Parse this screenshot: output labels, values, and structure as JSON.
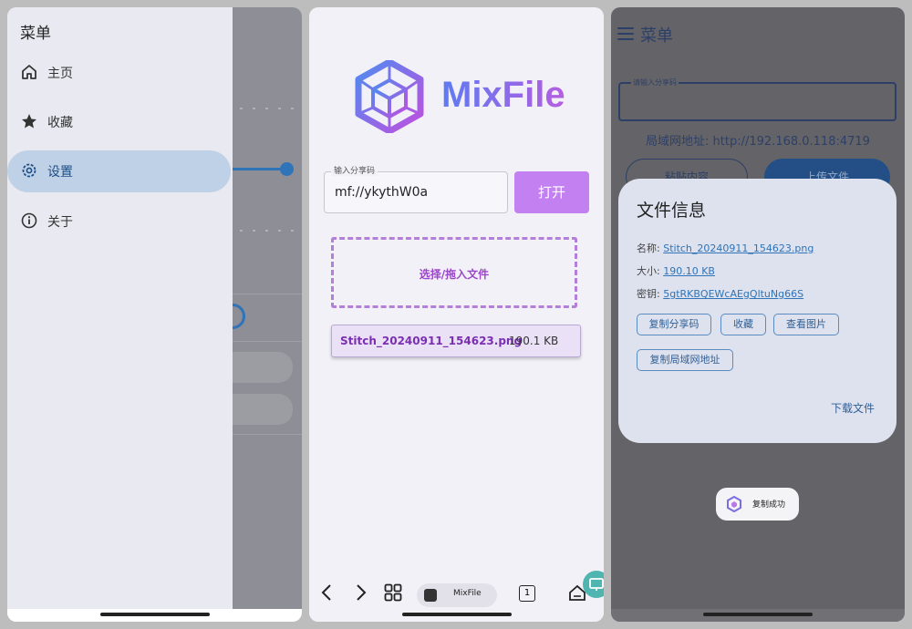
{
  "panel1": {
    "drawer_title": "菜单",
    "items": [
      {
        "label": "主页",
        "icon": "home-icon"
      },
      {
        "label": "收藏",
        "icon": "star-icon"
      },
      {
        "label": "设置",
        "icon": "gear-icon",
        "selected": true
      },
      {
        "label": "关于",
        "icon": "info-icon"
      }
    ],
    "accent": "#2f73b8"
  },
  "panel2": {
    "app_name": "MixFile",
    "share_code_label": "输入分享码",
    "share_code_value": "mf://ykythW0a",
    "open_button": "打开",
    "dropzone_text": "选择/拖入文件",
    "file_name": "Stitch_20240911_154623.png",
    "file_size": "190.1 KB",
    "browser_tab_title": "MixFile",
    "tab_count": "1",
    "brand_color": "#c280f0"
  },
  "panel3": {
    "title": "菜单",
    "input_placeholder": "请输入分享码",
    "lan_address": "局域网地址: http://192.168.0.118:4719",
    "paste_button": "粘贴内容",
    "upload_button": "上传文件",
    "dialog": {
      "title": "文件信息",
      "name_label": "名称:",
      "name_value": "Stitch_20240911_154623.png",
      "size_label": "大小:",
      "size_value": "190.10 KB",
      "key_label": "密钥:",
      "key_value": "5gtRKBQEWcAEgQltuNg66S",
      "copy_share_code": "复制分享码",
      "favorite": "收藏",
      "view_image": "查看图片",
      "copy_lan_address": "复制局域网地址",
      "download": "下载文件"
    },
    "toast": "复制成功"
  }
}
